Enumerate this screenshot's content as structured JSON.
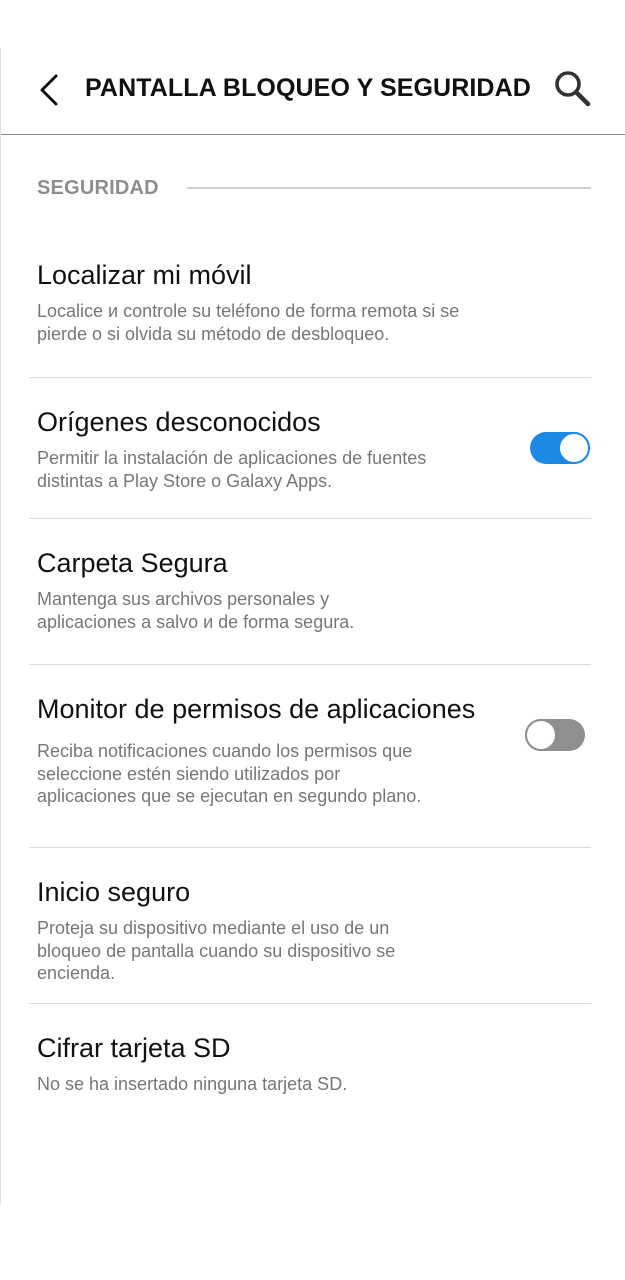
{
  "header": {
    "title": "PANTALLA BLOQUEO Y SEGURIDAD",
    "back_icon": "chevron-left-icon",
    "search_icon": "search-icon"
  },
  "section": {
    "label": "SEGURIDAD"
  },
  "items": [
    {
      "title": "Localizar mi móvil",
      "description": "Localice и controle su teléfono de forma remota si se pierde o si olvida su método de desbloqueo."
    },
    {
      "title": "Orígenes desconocidos",
      "description": "Permitir la instalación de aplicaciones de fuentes distintas a Play Store o Galaxy Apps.",
      "toggle_on": true
    },
    {
      "title": "Carpeta Segura",
      "description": "Mantenga sus archivos personales y aplicaciones a salvo и de forma segura."
    },
    {
      "title": "Monitor de permisos de aplicaciones",
      "description": "Reciba notificaciones cuando los permisos que seleccione estén siendo utilizados por aplicaciones que se ejecutan en segundo plano.",
      "toggle_on": false
    },
    {
      "title": "Inicio seguro",
      "description": "Proteja su dispositivo mediante el uso de un bloqueo de pantalla cuando su dispositivo se encienda."
    },
    {
      "title": "Cifrar tarjeta SD",
      "description": "No se ha insertado ninguna tarjeta SD."
    }
  ],
  "colors": {
    "accent": "#1e88e5",
    "toggle_off": "#8f8f8f",
    "secondary_text": "#777777",
    "section_text": "#8e8e8e"
  }
}
